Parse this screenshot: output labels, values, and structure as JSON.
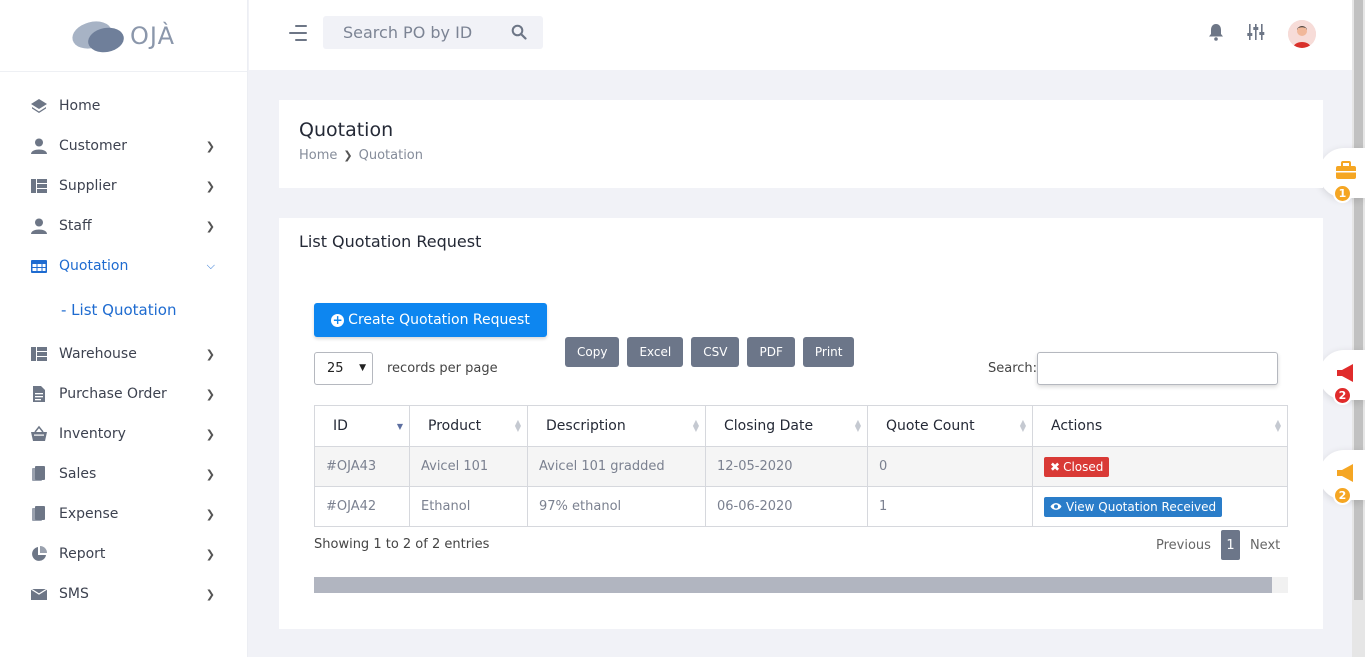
{
  "app": {
    "logo_text": "OJÀ"
  },
  "sidebar": {
    "items": [
      {
        "label": "Home",
        "icon": "layers-icon",
        "has_chevron": false
      },
      {
        "label": "Customer",
        "icon": "user-icon",
        "has_chevron": true
      },
      {
        "label": "Supplier",
        "icon": "grid-icon",
        "has_chevron": true
      },
      {
        "label": "Staff",
        "icon": "user-icon",
        "has_chevron": true
      },
      {
        "label": "Quotation",
        "icon": "table-icon",
        "has_chevron": true,
        "active": true
      },
      {
        "label": "Warehouse",
        "icon": "grid-icon",
        "has_chevron": true
      },
      {
        "label": "Purchase Order",
        "icon": "document-icon",
        "has_chevron": true
      },
      {
        "label": "Inventory",
        "icon": "basket-icon",
        "has_chevron": true
      },
      {
        "label": "Sales",
        "icon": "files-icon",
        "has_chevron": true
      },
      {
        "label": "Expense",
        "icon": "files-icon",
        "has_chevron": true
      },
      {
        "label": "Report",
        "icon": "pie-chart-icon",
        "has_chevron": true
      },
      {
        "label": "SMS",
        "icon": "inbox-icon",
        "has_chevron": true
      }
    ],
    "sub_item": "- List Quotation"
  },
  "topbar": {
    "search_placeholder": "Search PO by ID"
  },
  "page": {
    "title": "Quotation",
    "breadcrumb": {
      "home": "Home",
      "current": "Quotation"
    }
  },
  "list": {
    "title": "List Quotation Request",
    "create_button": "Create Quotation Request",
    "export_buttons": [
      "Copy",
      "Excel",
      "CSV",
      "PDF",
      "Print"
    ],
    "page_length": "25",
    "records_label": "records per page",
    "search_label": "Search:",
    "columns": [
      "ID",
      "Product",
      "Description",
      "Closing Date",
      "Quote Count",
      "Actions"
    ],
    "rows": [
      {
        "id": "#OJA43",
        "product": "Avicel 101",
        "description": "Avicel 101 gradded",
        "closing_date": "12-05-2020",
        "quote_count": "0",
        "action": "Closed"
      },
      {
        "id": "#OJA42",
        "product": "Ethanol",
        "description": "97% ethanol",
        "closing_date": "06-06-2020",
        "quote_count": "1",
        "action": "View Quotation Received"
      }
    ],
    "info": "Showing 1 to 2 of 2 entries",
    "pager": {
      "previous": "Previous",
      "page": "1",
      "next": "Next"
    }
  },
  "float_widgets": [
    {
      "icon": "briefcase-icon",
      "badge": "1",
      "color": "#f5a623"
    },
    {
      "icon": "megaphone-icon",
      "badge": "2",
      "color": "#e02b2b"
    },
    {
      "icon": "megaphone-icon",
      "badge": "2",
      "color": "#f5a623"
    }
  ]
}
